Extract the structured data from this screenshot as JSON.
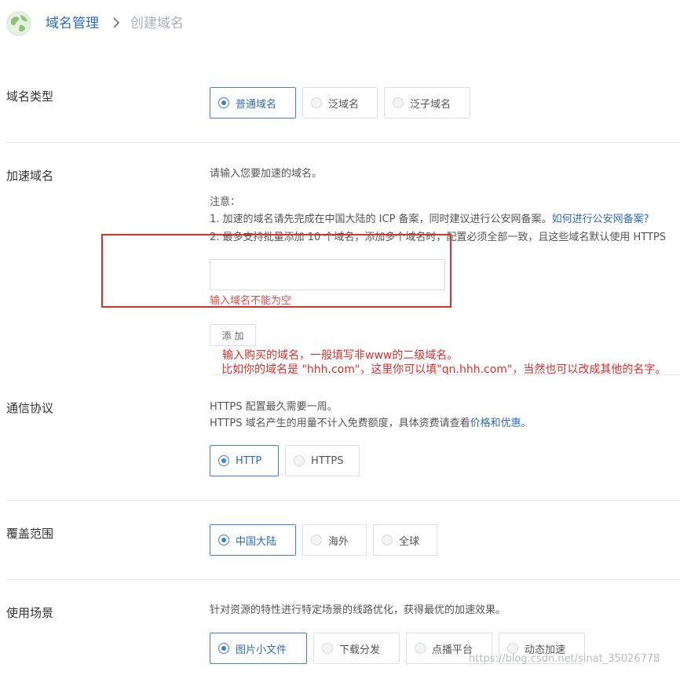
{
  "breadcrumb": {
    "parent": "域名管理",
    "current": "创建域名"
  },
  "domain_type": {
    "label": "域名类型",
    "options": [
      "普通域名",
      "泛域名",
      "泛子域名"
    ],
    "selected": "普通域名"
  },
  "accel_domain": {
    "label": "加速域名",
    "hint": "请输入您要加速的域名。",
    "note_title": "注意：",
    "note1_prefix": "1. 加速的域名请先完成在中国大陆的 ICP 备案，同时建议进行公安网备案。",
    "note1_link": "如何进行公安网备案?",
    "note2": "2. 最多支持批量添加 10 个域名，添加多个域名时，配置必须全部一致，且这些域名默认使用 HTTPS",
    "input_value": "",
    "error": "输入域名不能为空",
    "add_button": "添加",
    "annotation_line1": "输入购买的域名，一般填写非www的二级域名。",
    "annotation_line2": "比如你的域名是 \"hhh.com\"，这里你可以填\"qn.hhh.com\"，当然也可以改成其他的名字。"
  },
  "protocol": {
    "label": "通信协议",
    "line1": "HTTPS 配置最久需要一周。",
    "line2_prefix": "HTTPS 域名产生的用量不计入免费额度，具体资费请查看",
    "line2_link": "价格和优惠",
    "line2_suffix": "。",
    "options": [
      "HTTP",
      "HTTPS"
    ],
    "selected": "HTTP"
  },
  "coverage": {
    "label": "覆盖范围",
    "options": [
      "中国大陆",
      "海外",
      "全球"
    ],
    "selected": "中国大陆"
  },
  "scenario": {
    "label": "使用场景",
    "hint": "针对资源的特性进行特定场景的线路优化，获得最优的加速效果。",
    "options": [
      "图片小文件",
      "下载分发",
      "点播平台",
      "动态加速"
    ],
    "selected": "图片小文件"
  },
  "watermark": "https://blog.csdn.net/sinat_35026778",
  "colors": {
    "accent": "#3f7fd8",
    "link": "#2f6bbf",
    "error": "#e04b4b",
    "annotation": "#d9302c"
  }
}
